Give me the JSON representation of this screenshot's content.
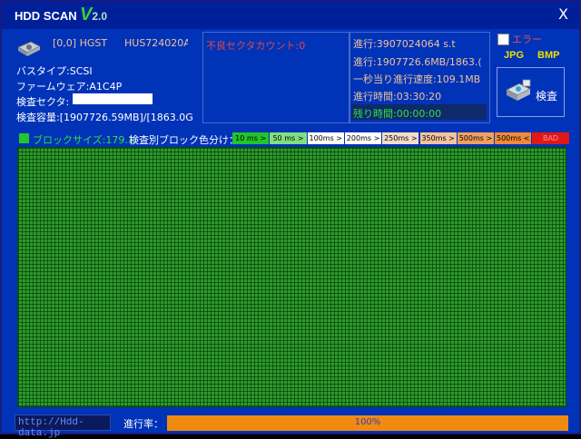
{
  "window": {
    "title": "HDD SCAN",
    "version_letter": "V",
    "version_number": "2.0",
    "close_label": "X"
  },
  "drive": {
    "id": "[0,0] HGST",
    "model": "HUS724020A",
    "bus_type": "バスタイプ:SCSI",
    "firmware": "ファームウェア:A1C4P",
    "sector_label": "検査セクタ:",
    "capacity": "検査容量:[1907726.59MB]/[1863.0G"
  },
  "bad_sectors": {
    "label": "不良セクタカウント:0"
  },
  "progress_panel": {
    "lines": [
      "進行:3907024064 s.t",
      "進行:1907726.6MB/1863.(",
      "一秒当り進行速度:109.1MB",
      "進行時間:03:30:20",
      "残り時間:00:00:00"
    ]
  },
  "options": {
    "error_label": "エラー",
    "error_checked": false,
    "jpg_label": "JPG",
    "bmp_label": "BMP",
    "scan_button_label": "検査"
  },
  "legend": {
    "block_size": "ブロックサイズ:179.1",
    "color_title": "検査別ブロック色分け：",
    "items": [
      {
        "label": "10 ms >",
        "color": "#22c42a",
        "text_color": "#000000"
      },
      {
        "label": "50 ms >",
        "color": "#80e080",
        "text_color": "#000000"
      },
      {
        "label": "100ms >",
        "color": "#ffffff",
        "text_color": "#000000"
      },
      {
        "label": "200ms >",
        "color": "#ffffff",
        "text_color": "#000000"
      },
      {
        "label": "250ms >",
        "color": "#f3dcc8",
        "text_color": "#000000"
      },
      {
        "label": "350ms >",
        "color": "#f2c39e",
        "text_color": "#000000"
      },
      {
        "label": "500ms >",
        "color": "#f0a060",
        "text_color": "#000000"
      },
      {
        "label": "500ms <",
        "color": "#f08a3a",
        "text_color": "#000000"
      },
      {
        "label": "BAD",
        "color": "#e01818",
        "text_color": "#ff9090"
      }
    ]
  },
  "grid": {
    "block_color": "#2b9a2b"
  },
  "footer": {
    "url": "http://Hdd-data.jp",
    "progress_label": "進行率：",
    "progress_percent": 100,
    "progress_text": "100%"
  }
}
